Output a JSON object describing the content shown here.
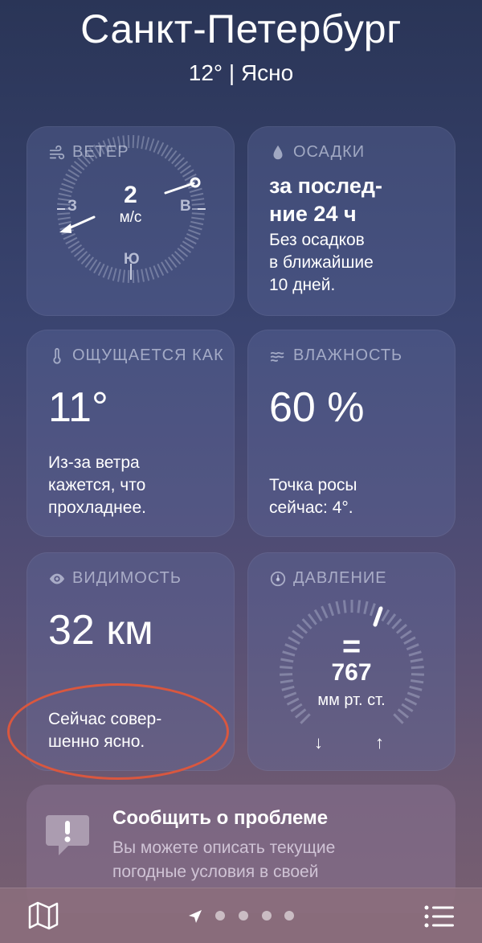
{
  "header": {
    "city": "Санкт-Петербург",
    "condition": "12°  |  Ясно"
  },
  "wind": {
    "title": "ВЕТЕР",
    "speed": "2",
    "unit": "м/с",
    "west": "З",
    "east": "В",
    "south": "Ю",
    "icon": "wind-icon"
  },
  "precip": {
    "title": "ОСАДКИ",
    "headline_1": "за послед-",
    "headline_2": "ние 24 ч",
    "desc_1": "Без осадков",
    "desc_2": "в ближайшие",
    "desc_3": "10 дней.",
    "icon": "drop-icon"
  },
  "feels": {
    "title": "ОЩУЩАЕТСЯ КАК",
    "value": "11°",
    "desc_1": "Из-за ветра",
    "desc_2": "кажется, что",
    "desc_3": "прохладнее.",
    "icon": "thermometer-icon"
  },
  "humidity": {
    "title": "ВЛАЖНОСТЬ",
    "value": "60 %",
    "desc_1": "Точка росы",
    "desc_2": "сейчас: 4°.",
    "icon": "humidity-icon"
  },
  "visibility": {
    "title": "ВИДИМОСТЬ",
    "value": "32 км",
    "desc_1": "Сейчас совер-",
    "desc_2": "шенно ясно.",
    "icon": "eye-icon"
  },
  "pressure": {
    "title": "ДАВЛЕНИЕ",
    "trend": "=",
    "value": "767",
    "unit": "мм рт. ст.",
    "low": "↓",
    "high": "↑",
    "icon": "gauge-icon"
  },
  "report": {
    "title": "Сообщить о проблеме",
    "text_1": "Вы можете описать текущие",
    "text_2": "погодные условия в своей",
    "icon": "exclamation-bubble-icon"
  },
  "bottom": {
    "map_icon": "map-icon",
    "location_icon": "location-arrow-icon",
    "list_icon": "list-icon",
    "pages": 4,
    "active_page": 0
  },
  "colors": {
    "annotation": "#d9573f"
  }
}
